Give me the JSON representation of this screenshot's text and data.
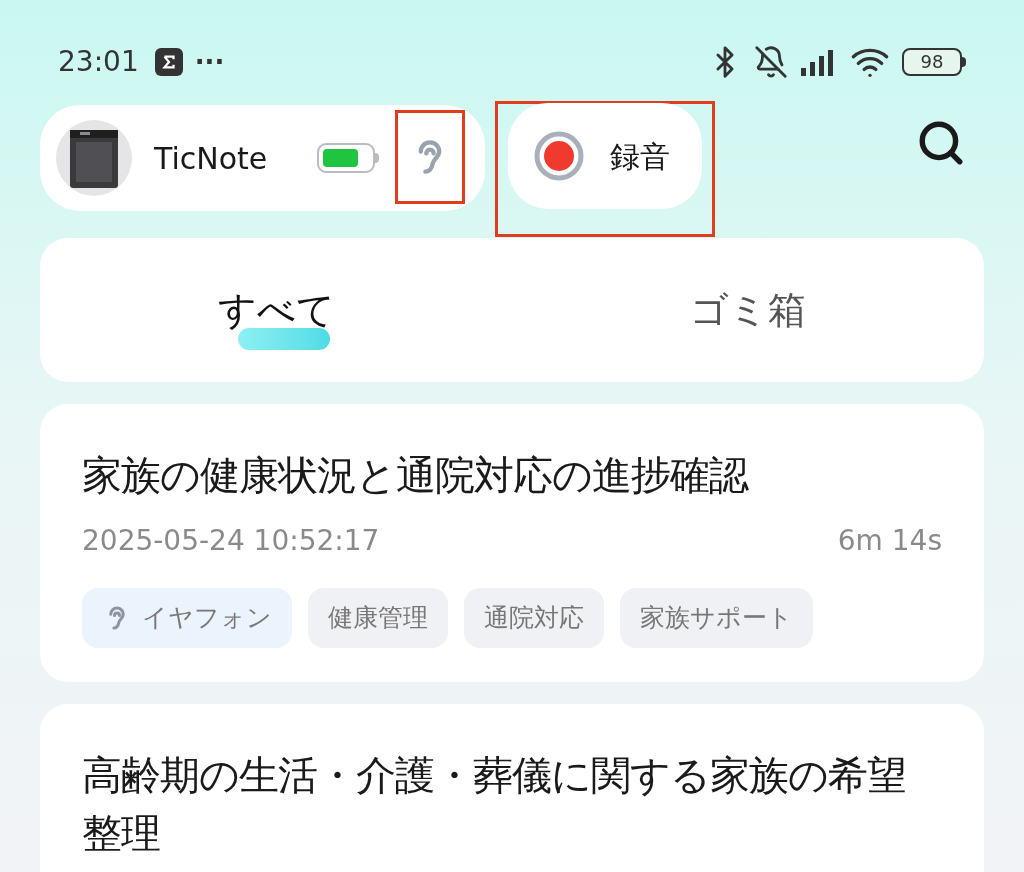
{
  "status_bar": {
    "time": "23:01",
    "more": "···",
    "battery": "98"
  },
  "device": {
    "name": "TicNote",
    "earphone_highlighted": true
  },
  "record_button": {
    "label": "録音",
    "highlighted": true
  },
  "tabs": [
    {
      "label": "すべて",
      "selected": true
    },
    {
      "label": "ゴミ箱",
      "selected": false
    }
  ],
  "recordings": [
    {
      "title": "家族の健康状況と通院対応の進捗確認",
      "datetime": "2025-05-24 10:52:17",
      "duration": "6m 14s",
      "tags": [
        {
          "kind": "source",
          "label": "イヤフォン"
        },
        {
          "kind": "topic",
          "label": "健康管理"
        },
        {
          "kind": "topic",
          "label": "通院対応"
        },
        {
          "kind": "topic",
          "label": "家族サポート"
        }
      ]
    },
    {
      "title": "高齢期の生活・介護・葬儀に関する家族の希望整理"
    }
  ]
}
